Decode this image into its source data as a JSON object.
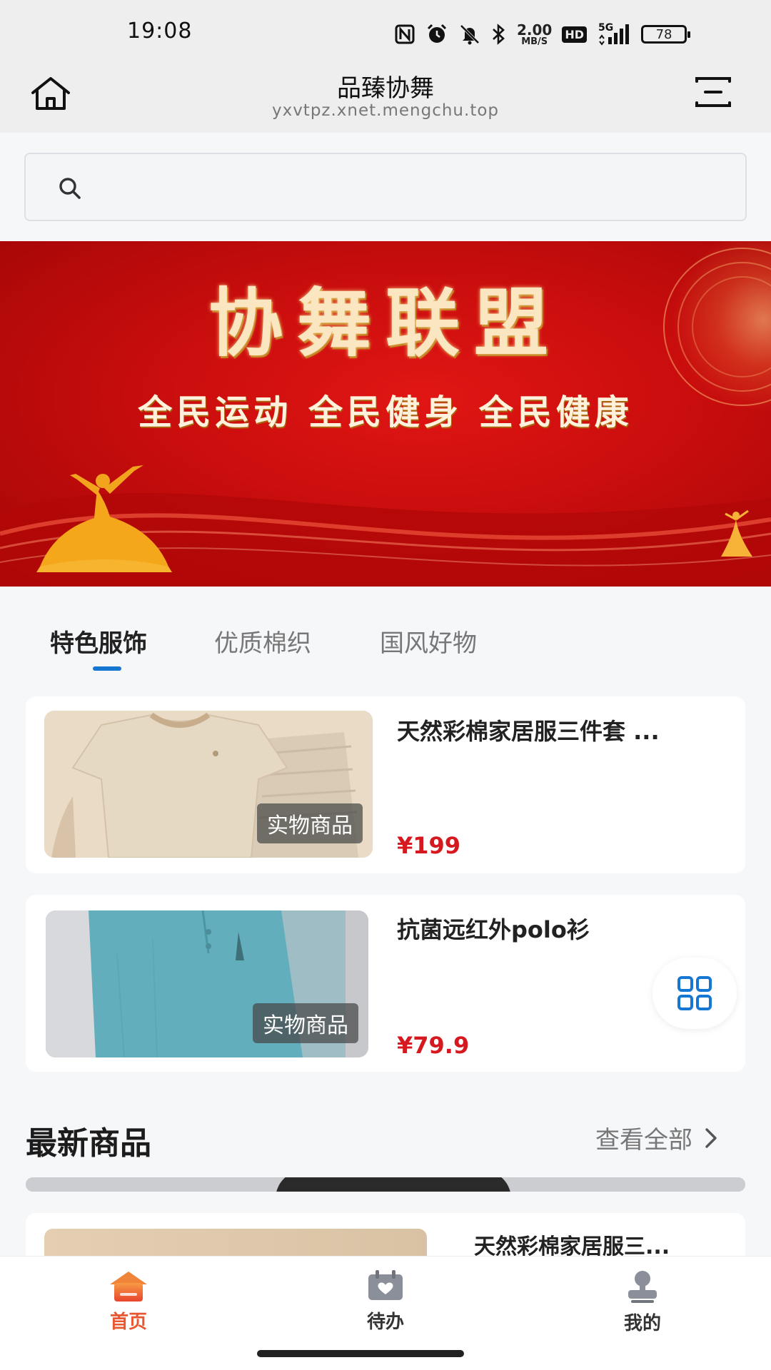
{
  "status_bar": {
    "time": "19:08",
    "net_speed_value": "2.00",
    "net_speed_unit": "MB/S",
    "hd_label": "HD",
    "signal_label": "5G",
    "battery_level": "78",
    "icons": [
      "nfc-icon",
      "alarm-icon",
      "mute-icon",
      "bluetooth-icon",
      "hd-icon",
      "signal-icon",
      "battery-icon"
    ]
  },
  "header": {
    "title": "品臻协舞",
    "url": "yxvtpz.xnet.mengchu.top"
  },
  "search": {
    "placeholder": ""
  },
  "banner": {
    "title": "协舞联盟",
    "subtitle": "全民运动  全民健身  全民健康"
  },
  "tabs": [
    {
      "label": "特色服饰",
      "active": true
    },
    {
      "label": "优质棉织",
      "active": false
    },
    {
      "label": "国风好物",
      "active": false
    }
  ],
  "products": [
    {
      "title": "天然彩棉家居服三件套 ...",
      "tag": "实物商品",
      "price": "¥199"
    },
    {
      "title": "抗菌远红外polo衫",
      "tag": "实物商品",
      "price": "¥79.9"
    }
  ],
  "latest": {
    "title": "最新商品",
    "view_all": "查看全部",
    "first_item_title": "天然彩棉家居服三..."
  },
  "bottom_nav": [
    {
      "label": "首页",
      "icon": "home-icon",
      "active": true
    },
    {
      "label": "待办",
      "icon": "calendar-icon",
      "active": false
    },
    {
      "label": "我的",
      "icon": "user-stamp-icon",
      "active": false
    }
  ],
  "colors": {
    "accent_blue": "#1677d2",
    "price_red": "#d6181f",
    "nav_active": "#e8572f",
    "banner_red": "#c90d0d"
  }
}
